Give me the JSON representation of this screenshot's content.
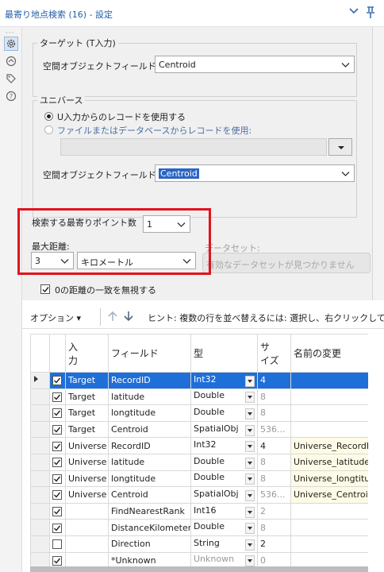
{
  "window": {
    "title": "最寄り地点検索 (16) - 設定"
  },
  "target": {
    "group_label": "ターゲット (T入力)",
    "spatial_field_label": "空間オブジェクトフィールド:",
    "spatial_field_value": "Centroid"
  },
  "universe": {
    "group_label": "ユニバース",
    "radio_u_label": "U入力からのレコードを使用する",
    "radio_file_label": "ファイルまたはデータベースからレコードを使用:",
    "spatial_field_label": "空間オブジェクトフィールド:",
    "spatial_field_value": "Centroid"
  },
  "search": {
    "nearest_count_label": "検索する最寄りポイント数",
    "nearest_count_value": "1",
    "max_distance_label": "最大距離:",
    "max_distance_value": "3",
    "unit_value": "キロメートル",
    "dataset_label": "データセット:",
    "dataset_value": "有効なデータセットが見つかりません",
    "ignore_zero_label": "0の距離の一致を無視する"
  },
  "grid_toolbar": {
    "options_label": "オプション",
    "hint": "ヒント: 複数の行を並べ替えるには: 選択し、右クリックしてドラッ"
  },
  "grid": {
    "headers": [
      "入力",
      "フィールド",
      "型",
      "サイズ",
      "名前の変更"
    ],
    "rows": [
      {
        "input": "Target",
        "field": "RecordID",
        "type": "Int32",
        "size": "4",
        "rename": ""
      },
      {
        "input": "Target",
        "field": "latitude",
        "type": "Double",
        "size": "8",
        "rename": ""
      },
      {
        "input": "Target",
        "field": "longtitude",
        "type": "Double",
        "size": "8",
        "rename": ""
      },
      {
        "input": "Target",
        "field": "Centroid",
        "type": "SpatialObj",
        "size": "536...",
        "rename": ""
      },
      {
        "input": "Universe",
        "field": "RecordID",
        "type": "Int32",
        "size": "4",
        "rename": "Universe_RecordID"
      },
      {
        "input": "Universe",
        "field": "latitude",
        "type": "Double",
        "size": "8",
        "rename": "Universe_latitude"
      },
      {
        "input": "Universe",
        "field": "longtitude",
        "type": "Double",
        "size": "8",
        "rename": "Universe_longtitude"
      },
      {
        "input": "Universe",
        "field": "Centroid",
        "type": "SpatialObj",
        "size": "536...",
        "rename": "Universe_Centroid"
      },
      {
        "input": "",
        "field": "FindNearestRank",
        "type": "Int16",
        "size": "2",
        "rename": ""
      },
      {
        "input": "",
        "field": "DistanceKilometers",
        "type": "Double",
        "size": "8",
        "rename": ""
      },
      {
        "input": "",
        "field": "Direction",
        "type": "String",
        "size": "2",
        "rename": ""
      },
      {
        "input": "",
        "field": "*Unknown",
        "type": "Unknown",
        "size": "0",
        "rename": ""
      }
    ]
  }
}
